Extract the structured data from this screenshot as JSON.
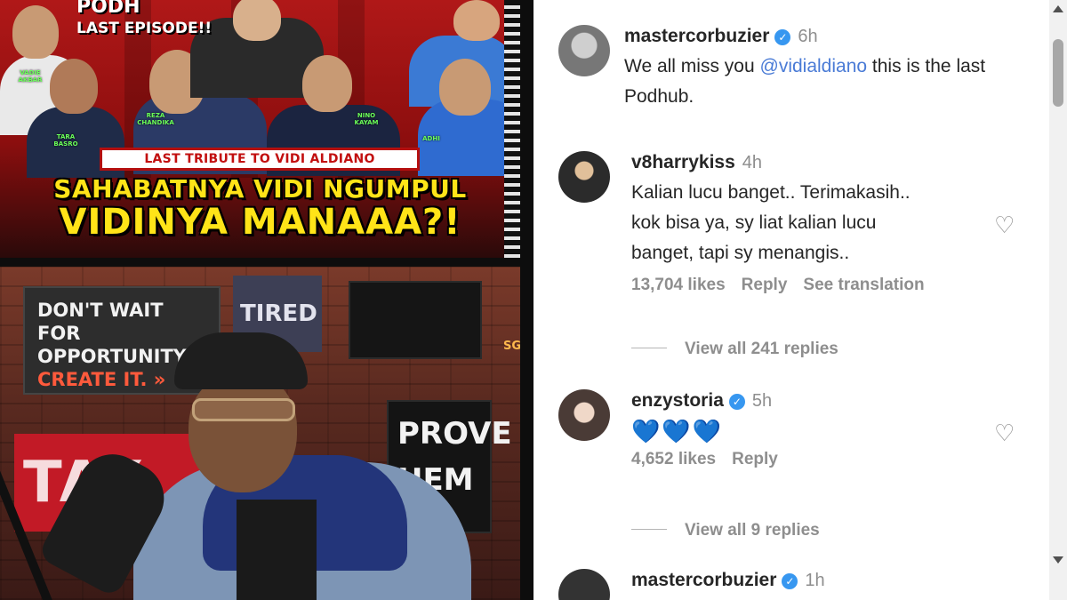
{
  "thumbnail": {
    "title_top": "PODH",
    "title_sub": "LAST EPISODE!!",
    "tribute": "LAST TRIBUTE TO VIDI ALDIANO",
    "headline_1": "SAHABATNYA VIDI NGUMPUL",
    "headline_2": "VIDINYA MANAAA?!",
    "name_tags": [
      "VADIE AKBAR",
      "TARA BASRO",
      "REZA CHANDIKA",
      "NINO KAYAM",
      "ADHI"
    ]
  },
  "video": {
    "sign_wait_line1": "DON'T WAIT FOR",
    "sign_wait_line2": "OPPORTUNITY,",
    "sign_wait_line3": "CREATE IT. »",
    "sign_tired": "TIRED",
    "sign_prove_line1": "PROVE",
    "sign_prove_line2": "HEM",
    "sign_red": "TAY",
    "side_letters": "SGASG"
  },
  "comments": [
    {
      "username": "mastercorbuzier",
      "verified": true,
      "time": "6h",
      "text_before": "We all miss you ",
      "mention": "@vidialdiano",
      "text_after": " this is the last Podhub."
    },
    {
      "username": "v8harrykiss",
      "verified": false,
      "time": "4h",
      "text": "Kalian lucu banget.. Terimakasih.. kok bisa ya, sy liat kalian lucu banget, tapi sy menangis..",
      "likes": "13,704 likes",
      "reply": "Reply",
      "translate": "See translation",
      "view_replies": "View all 241 replies"
    },
    {
      "username": "enzystoria",
      "verified": true,
      "time": "5h",
      "text": "💙💙💙",
      "likes": "4,652 likes",
      "reply": "Reply",
      "view_replies": "View all 9 replies"
    },
    {
      "username": "mastercorbuzier",
      "verified": true,
      "time": "1h"
    }
  ],
  "icons": {
    "heart": "♡",
    "verified": "✓"
  },
  "colors": {
    "mention": "#4a7bd6",
    "verified": "#3797f0",
    "muted": "#8e8e8e"
  }
}
